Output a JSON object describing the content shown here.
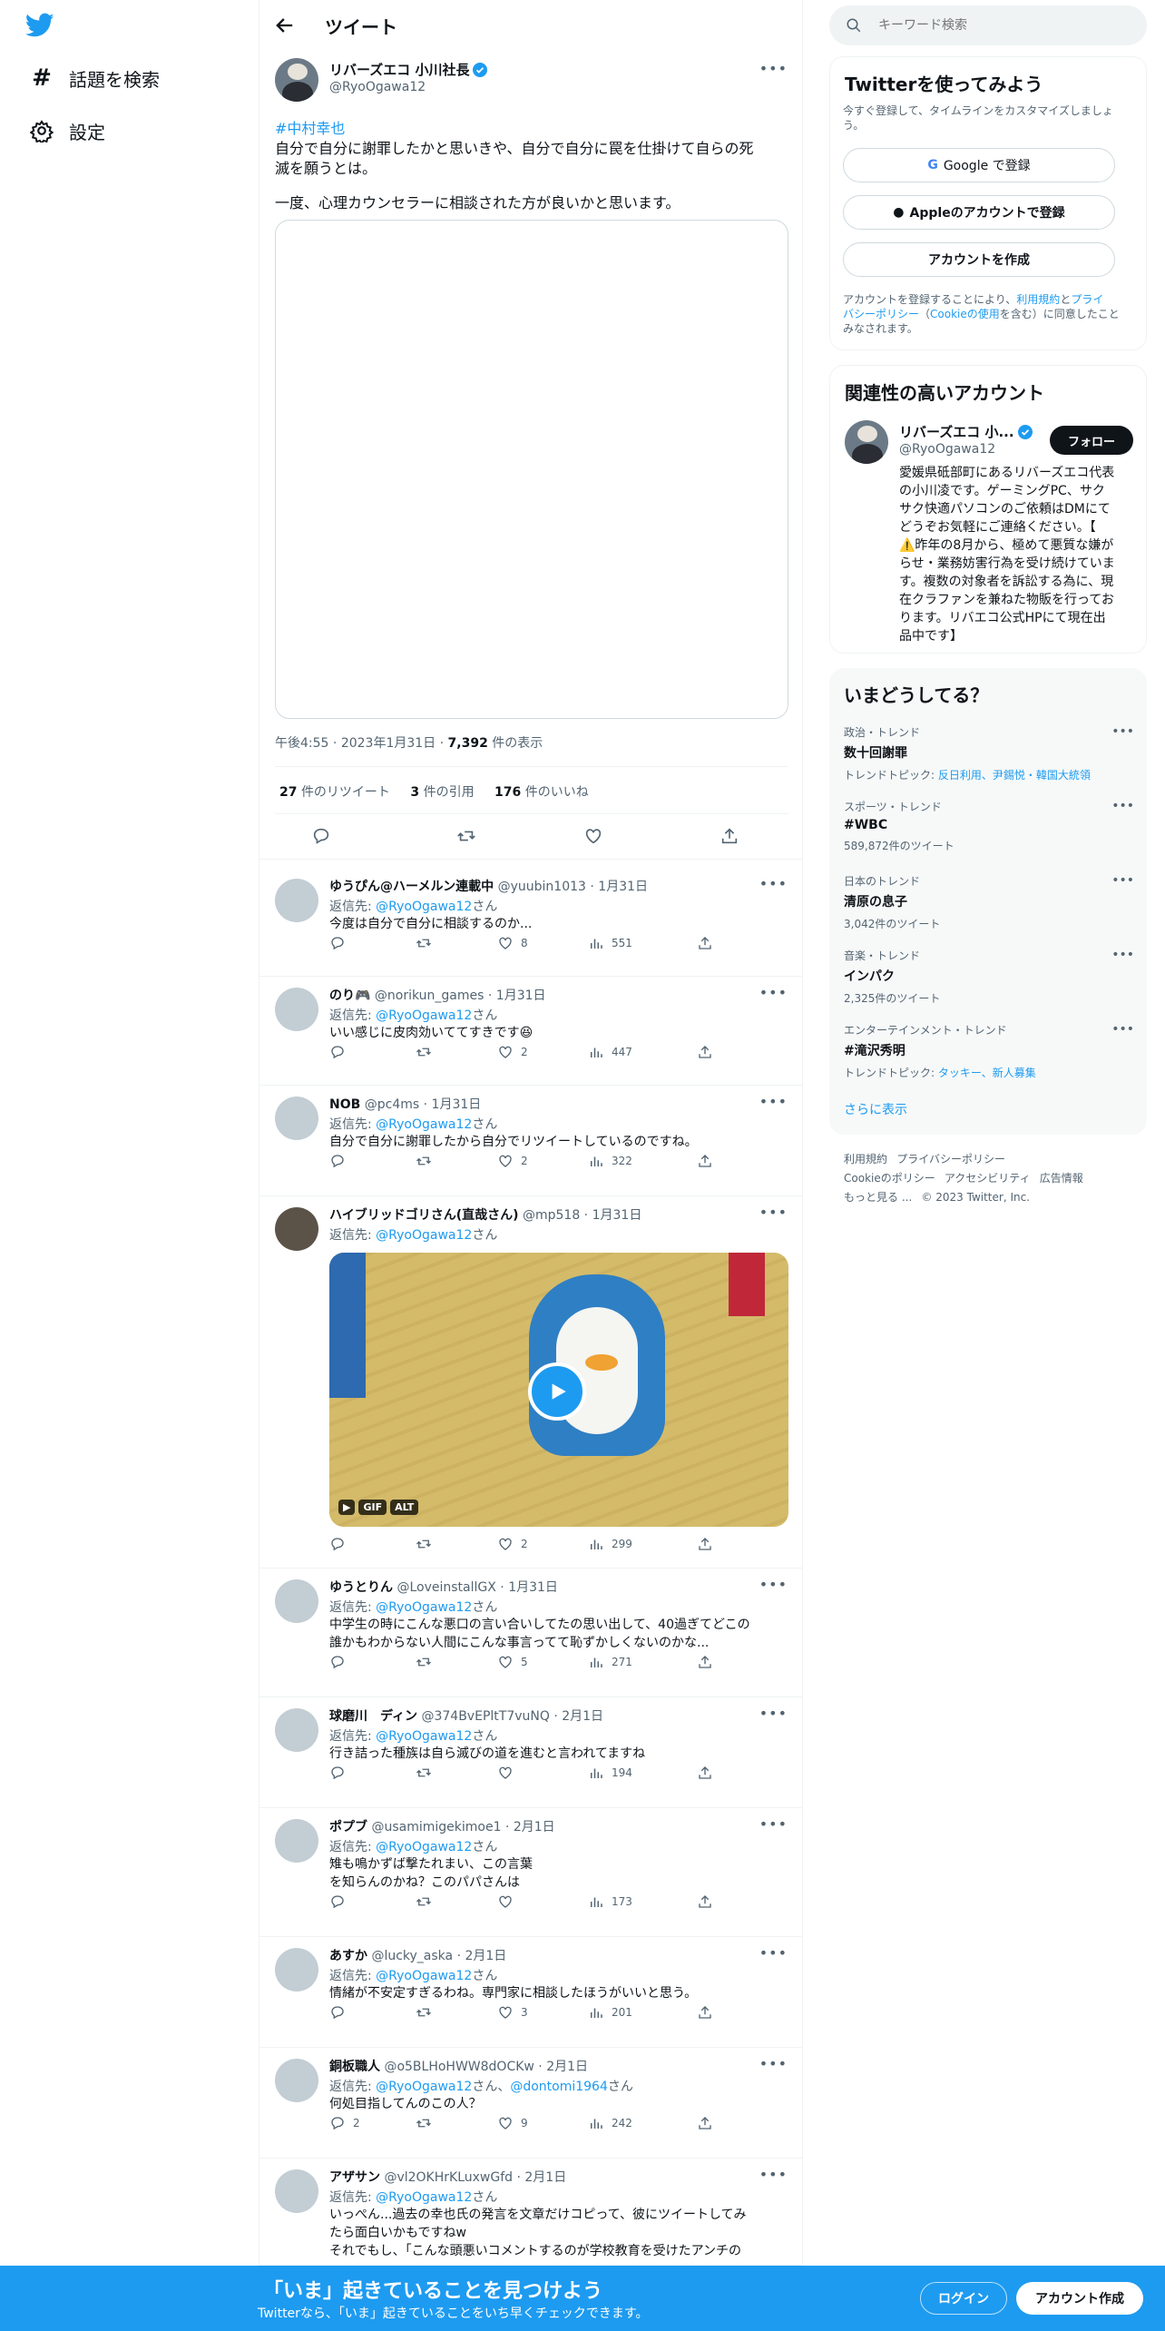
{
  "colors": {
    "accent": "#1d9bf0",
    "bottom_bar": "#1d9bf0",
    "text": "#0f1419",
    "muted": "#536471"
  },
  "nav": {
    "logo": "twitter-bird-icon",
    "explore": "話題を検索",
    "settings": "設定"
  },
  "header": {
    "title": "ツイート",
    "back_icon": "arrow-left-icon"
  },
  "tweet": {
    "name": "リバーズエコ 小川社長",
    "handle": "@RyoOgawa12",
    "hashtag": "#中村幸也",
    "text1": "自分で自分に謝罪したかと思いきや、自分で自分に罠を仕掛けて自らの死",
    "text2": "滅を願うとは。",
    "text3": "一度、心理カウンセラーに相談された方が良いかと思います。",
    "time": "午後4:55",
    "date": "2023年1月31日",
    "views": "7,392",
    "views_label": "件の表示",
    "retweets": "27",
    "retweets_label": "件のリツイート",
    "quotes": "3",
    "quotes_label": "件の引用",
    "likes": "176",
    "likes_label": "件のいいね"
  },
  "reply_to": "返信先:",
  "san": "さん",
  "replies": [
    {
      "name": "ゆうぴん@ハーメルン連載中",
      "handle": "@yuubin1013",
      "date": "1月31日",
      "to": "@RyoOgawa12",
      "text": "今度は自分で自分に相談するのか...",
      "reply": "",
      "rt": "",
      "like": "8",
      "views": "551"
    },
    {
      "name": "のり🎮",
      "handle": "@norikun_games",
      "date": "1月31日",
      "to": "@RyoOgawa12",
      "text": "いい感じに皮肉効いててすきです😆",
      "reply": "",
      "rt": "",
      "like": "2",
      "views": "447"
    },
    {
      "name": "NOB",
      "handle": "@pc4ms",
      "date": "1月31日",
      "to": "@RyoOgawa12",
      "text": "自分で自分に謝罪したから自分でリツイートしているのですね。",
      "reply": "",
      "rt": "",
      "like": "2",
      "views": "322"
    },
    {
      "name": "ハイブリッドゴリさん(直哉さん)",
      "handle": "@mp518",
      "date": "1月31日",
      "to": "@RyoOgawa12",
      "text": "",
      "reply": "",
      "rt": "",
      "like": "2",
      "views": "299",
      "media": {
        "badge_gif": "GIF",
        "badge_alt": "ALT",
        "play_icon": "play-icon"
      }
    },
    {
      "name": "ゆうとりん",
      "handle": "@LoveinstallGX",
      "date": "1月31日",
      "to": "@RyoOgawa12",
      "text": "中学生の時にこんな悪口の言い合いしてたの思い出して、40過ぎてどこの",
      "text2": "誰かもわからない人間にこんな事言ってて恥ずかしくないのかな...",
      "reply": "",
      "rt": "",
      "like": "5",
      "views": "271"
    },
    {
      "name": "球磨川　ディン",
      "handle": "@374BvEPltT7vuNQ",
      "date": "2月1日",
      "to": "@RyoOgawa12",
      "text": "行き詰った種族は自ら滅びの道を進むと言われてますね",
      "reply": "",
      "rt": "",
      "like": "",
      "views": "194"
    },
    {
      "name": "ポプブ",
      "handle": "@usamimigekimoe1",
      "date": "2月1日",
      "to": "@RyoOgawa12",
      "text": "雉も鳴かずば撃たれまい、この言葉",
      "text2": "を知らんのかね？このパパさんは",
      "reply": "",
      "rt": "",
      "like": "",
      "views": "173"
    },
    {
      "name": "あすか",
      "handle": "@lucky_aska",
      "date": "2月1日",
      "to": "@RyoOgawa12",
      "text": "情緒が不安定すぎるわね。専門家に相談したほうがいいと思う。",
      "reply": "",
      "rt": "",
      "like": "3",
      "views": "201"
    },
    {
      "name": "銅板職人",
      "handle": "@o5BLHoHWW8dOCKw",
      "date": "2月1日",
      "to": "@RyoOgawa12",
      "to2": "@dontomi1964",
      "sep": "、",
      "text": "何処目指してんのこの人？",
      "reply": "2",
      "rt": "",
      "like": "9",
      "views": "242"
    },
    {
      "name": "アザサン",
      "handle": "@vl2OKHrKLuxwGfd",
      "date": "2月1日",
      "to": "@RyoOgawa12",
      "text": "いっぺん...過去の幸也氏の発言を文章だけコピって、彼にツイートしてみ",
      "text2": "たら面白いかもですねw",
      "text3": "それでもし、「こんな頭悪いコメントするのが学校教育を受けたアンチの"
    }
  ],
  "search": {
    "placeholder": "キーワード検索"
  },
  "signup": {
    "title": "Twitterを使ってみよう",
    "desc1": "今すぐ登録して、タイムラインをカスタマイズしましょ",
    "desc2": "う。",
    "google": "Google で登録",
    "apple": "Appleのアカウントで登録",
    "create": "アカウントを作成",
    "terms1a": "アカウントを登録することにより、",
    "terms_link1": "利用規約",
    "terms1b": "と",
    "terms_link2": "プライ",
    "terms2a": "バシーポリシー",
    "terms2b": "（",
    "terms_link3": "Cookieの使用",
    "terms2c": "を含む）に同意したこと",
    "terms3": "みなされます。"
  },
  "related": {
    "title": "関連性の高いアカウント",
    "name": "リバーズエコ 小...",
    "handle": "@RyoOgawa12",
    "follow": "フォロー",
    "bio": [
      "愛媛県砥部町にあるリバーズエコ代表",
      "の小川凌です。ゲーミングPC、サク",
      "サク快適パソコンのご依頼はDMにて",
      "どうぞお気軽にご連絡ください。【",
      "⚠️昨年の8月から、極めて悪質な嫌が",
      "らせ・業務妨害行為を受け続けていま",
      "す。複数の対象者を訴訟する為に、現",
      "在クラファンを兼ねた物販を行ってお",
      "ります。リバエコ公式HPにて現在出",
      "品中です】"
    ]
  },
  "trends": {
    "title": "いまどうしてる？",
    "items": [
      {
        "cat": "政治・トレンド",
        "title": "数十回謝罪",
        "sub_label": "トレンドトピック: ",
        "topics": "反日利用、尹錫悦・韓国大統領"
      },
      {
        "cat": "スポーツ・トレンド",
        "title": "#WBC",
        "sub": "589,872件のツイート"
      },
      {
        "cat": "日本のトレンド",
        "title": "清原の息子",
        "sub": "3,042件のツイート"
      },
      {
        "cat": "音楽・トレンド",
        "title": "インパク",
        "sub": "2,325件のツイート"
      },
      {
        "cat": "エンターテインメント・トレンド",
        "title": "#滝沢秀明",
        "sub_label": "トレンドトピック: ",
        "topics": "タッキー、新人募集"
      }
    ],
    "more": "さらに表示"
  },
  "footer": {
    "l1": "利用規約",
    "l2": "プライバシーポリシー",
    "l3": "Cookieのポリシー",
    "l4": "アクセシビリティ",
    "l5": "広告情報",
    "l6": "もっと見る ...",
    "copy": "© 2023 Twitter, Inc."
  },
  "bottom": {
    "title": "「いま」起きていることを見つけよう",
    "sub": "Twitterなら、「いま」起きていることをいち早くチェックできます。",
    "login": "ログイン",
    "signup": "アカウント作成"
  }
}
